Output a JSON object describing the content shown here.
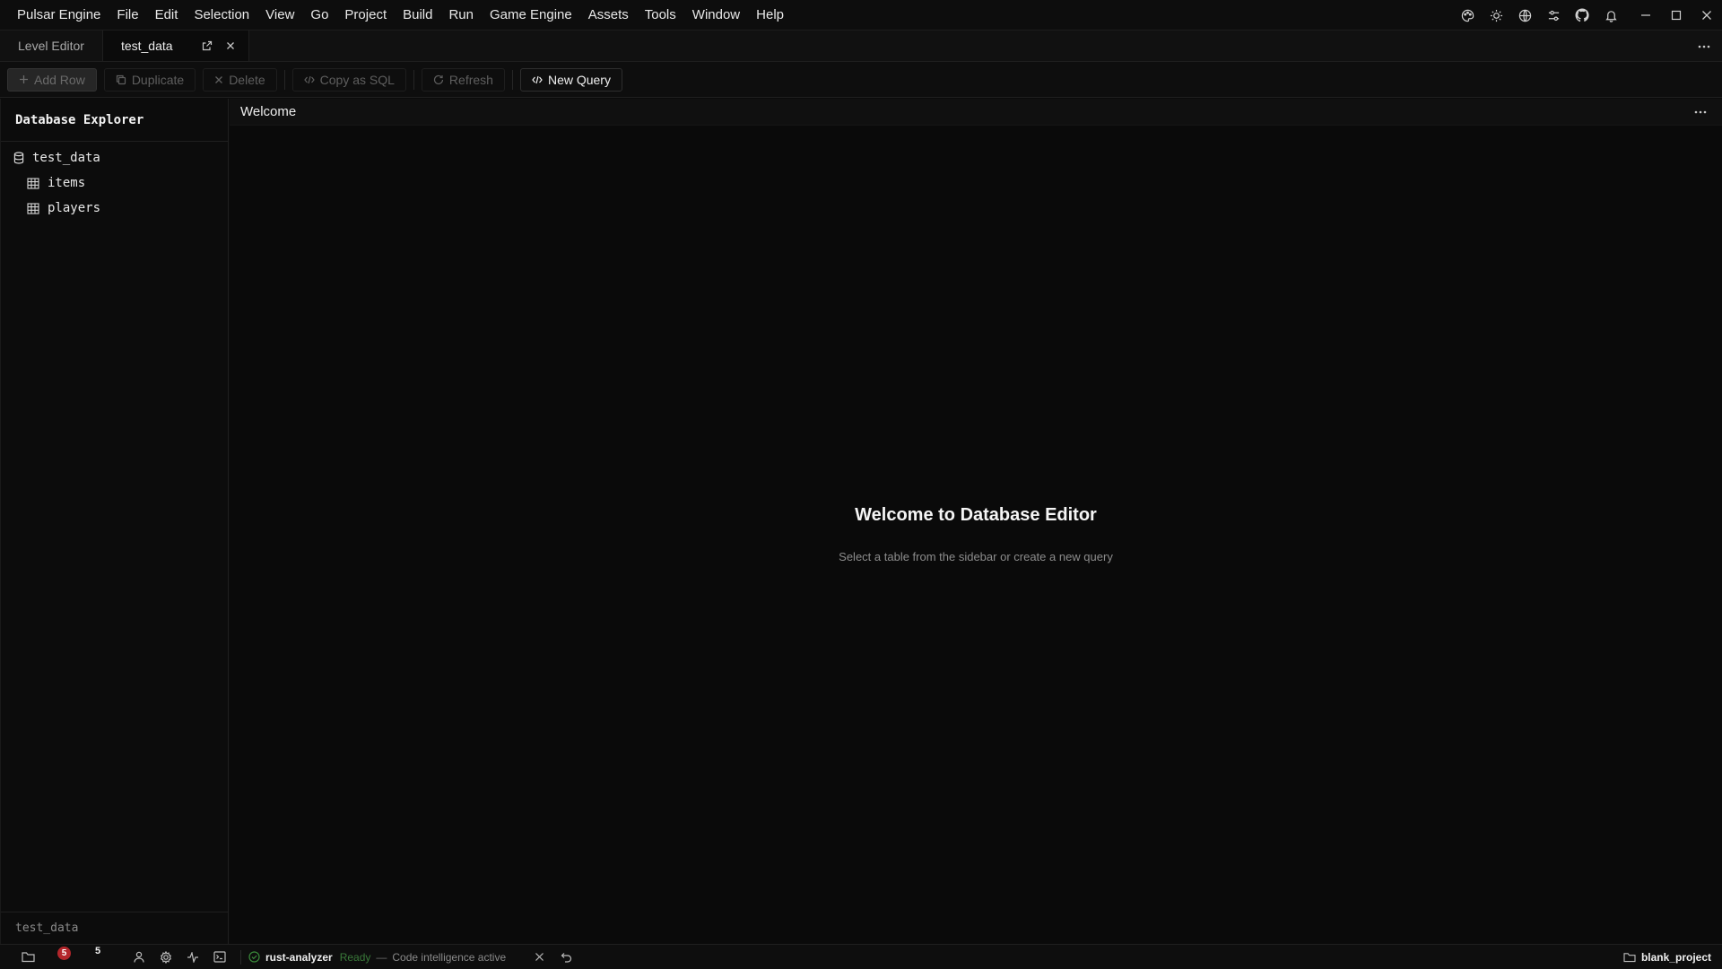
{
  "menubar": {
    "items": [
      "Pulsar Engine",
      "File",
      "Edit",
      "Selection",
      "View",
      "Go",
      "Project",
      "Build",
      "Run",
      "Game Engine",
      "Assets",
      "Tools",
      "Window",
      "Help"
    ],
    "icons": [
      "palette-icon",
      "sun-icon",
      "globe-icon",
      "sliders-icon",
      "github-icon",
      "bell-icon"
    ],
    "window_controls": [
      "minimize-icon",
      "maximize-icon",
      "close-icon"
    ]
  },
  "tabs": [
    {
      "label": "Level Editor",
      "active": false
    },
    {
      "label": "test_data",
      "active": true
    }
  ],
  "toolbar": {
    "add_row": "Add Row",
    "duplicate": "Duplicate",
    "delete": "Delete",
    "copy_sql": "Copy as SQL",
    "refresh": "Refresh",
    "new_query": "New Query"
  },
  "sidebar": {
    "title": "Database Explorer",
    "database": "test_data",
    "tables": [
      "items",
      "players"
    ],
    "footer": "test_data"
  },
  "main": {
    "header": "Welcome",
    "title": "Welcome to Database Editor",
    "subtitle": "Select a table from the sidebar or create a new query"
  },
  "statusbar": {
    "problems_count": "5",
    "warnings_count": "5",
    "lsp_name": "rust-analyzer",
    "lsp_status": "Ready",
    "separator": "—",
    "lsp_message": "Code intelligence active",
    "project": "blank_project"
  },
  "colors": {
    "background": "#0b0b0b",
    "error_badge": "#b3262b",
    "ready_green": "#3a7a3a"
  }
}
